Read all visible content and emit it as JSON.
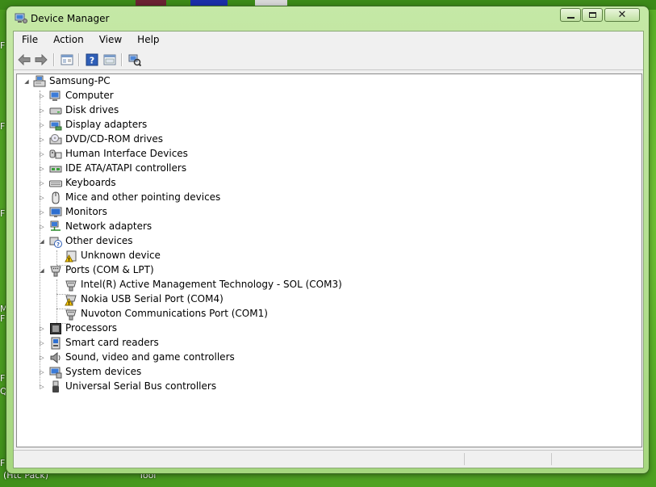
{
  "window": {
    "title": "Device Manager"
  },
  "menu": [
    "File",
    "Action",
    "View",
    "Help"
  ],
  "toolbar": {
    "back_icon": "back-arrow-icon",
    "forward_icon": "forward-arrow-icon",
    "console_tree_icon": "show-hide-console-tree-icon",
    "help_icon": "help-icon",
    "properties_icon": "properties-icon",
    "scan_icon": "scan-hardware-icon"
  },
  "tree": {
    "root": {
      "label": "Samsung-PC",
      "icon": "computer-root-icon",
      "expanded": true
    },
    "categories": [
      {
        "label": "Computer",
        "icon": "computer-icon",
        "expanded": false
      },
      {
        "label": "Disk drives",
        "icon": "disk-drive-icon",
        "expanded": false
      },
      {
        "label": "Display adapters",
        "icon": "display-adapter-icon",
        "expanded": false
      },
      {
        "label": "DVD/CD-ROM drives",
        "icon": "dvd-drive-icon",
        "expanded": false
      },
      {
        "label": "Human Interface Devices",
        "icon": "hid-icon",
        "expanded": false
      },
      {
        "label": "IDE ATA/ATAPI controllers",
        "icon": "ide-controller-icon",
        "expanded": false
      },
      {
        "label": "Keyboards",
        "icon": "keyboard-icon",
        "expanded": false
      },
      {
        "label": "Mice and other pointing devices",
        "icon": "mouse-icon",
        "expanded": false
      },
      {
        "label": "Monitors",
        "icon": "monitor-icon",
        "expanded": false
      },
      {
        "label": "Network adapters",
        "icon": "network-adapter-icon",
        "expanded": false
      },
      {
        "label": "Other devices",
        "icon": "other-devices-icon",
        "expanded": true,
        "children": [
          {
            "label": "Unknown device",
            "icon": "unknown-device-warning-icon",
            "warning": true
          }
        ]
      },
      {
        "label": "Ports (COM & LPT)",
        "icon": "port-icon",
        "expanded": true,
        "children": [
          {
            "label": "Intel(R) Active Management Technology - SOL (COM3)",
            "icon": "port-icon",
            "warning": false
          },
          {
            "label": "Nokia USB Serial Port (COM4)",
            "icon": "port-warning-icon",
            "warning": true
          },
          {
            "label": "Nuvoton Communications Port (COM1)",
            "icon": "port-icon",
            "warning": false
          }
        ]
      },
      {
        "label": "Processors",
        "icon": "processor-icon",
        "expanded": false
      },
      {
        "label": "Smart card readers",
        "icon": "smart-card-reader-icon",
        "expanded": false
      },
      {
        "label": "Sound, video and game controllers",
        "icon": "sound-icon",
        "expanded": false
      },
      {
        "label": "System devices",
        "icon": "system-devices-icon",
        "expanded": false
      },
      {
        "label": "Universal Serial Bus controllers",
        "icon": "usb-controller-icon",
        "expanded": false
      }
    ]
  },
  "desktop": {
    "left_edge_letters": [
      "F",
      "F",
      "F",
      "M",
      "F",
      "F",
      "Q",
      "F"
    ],
    "bottom_labels": [
      "(Htc Pack)",
      "Tool"
    ]
  },
  "colors": {
    "desktop": "#5fb52a",
    "window_frame": "#b8e094",
    "warning": "#f2c200"
  }
}
